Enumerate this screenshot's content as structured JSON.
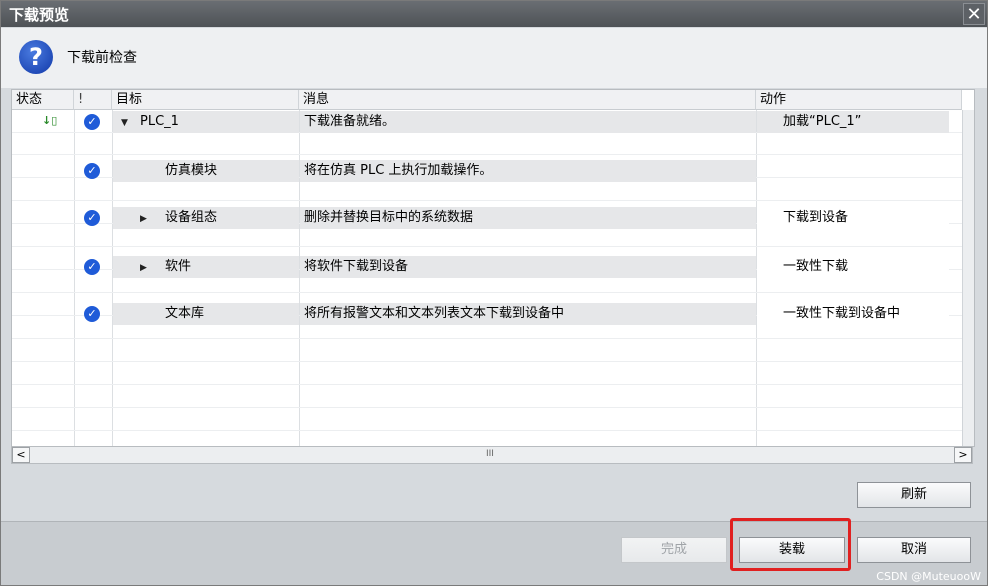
{
  "dialog": {
    "title": "下载预览",
    "close_label": "✕",
    "header_text": "下载前检查"
  },
  "table": {
    "columns": [
      "状态",
      "!",
      "目标",
      "消息",
      "动作"
    ],
    "rows": [
      {
        "status": "↓▯",
        "check": "✓",
        "expand": "▼",
        "target": "PLC_1",
        "message": "下载准备就绪。",
        "action": "加载“PLC_1”"
      },
      {
        "status": "",
        "check": "✓",
        "expand": "",
        "target": "仿真模块",
        "message": "将在仿真 PLC 上执行加载操作。",
        "action": ""
      },
      {
        "status": "",
        "check": "✓",
        "expand": "▶",
        "target": "设备组态",
        "message": "删除并替换目标中的系统数据",
        "action": "下载到设备"
      },
      {
        "status": "",
        "check": "✓",
        "expand": "▶",
        "target": "软件",
        "message": "将软件下载到设备",
        "action": "一致性下载"
      },
      {
        "status": "",
        "check": "✓",
        "expand": "",
        "target": "文本库",
        "message": "将所有报警文本和文本列表文本下载到设备中",
        "action": "一致性下载到设备中"
      }
    ]
  },
  "scroll": {
    "left": "<",
    "right": ">",
    "grip": "III"
  },
  "buttons": {
    "refresh": "刷新",
    "finish": "完成",
    "load": "装载",
    "cancel": "取消"
  },
  "watermark": "CSDN @MuteuooW",
  "colors": {
    "accent": "#1f5bd8",
    "highlight": "#e02020",
    "titlebar": "#5a5e62"
  }
}
